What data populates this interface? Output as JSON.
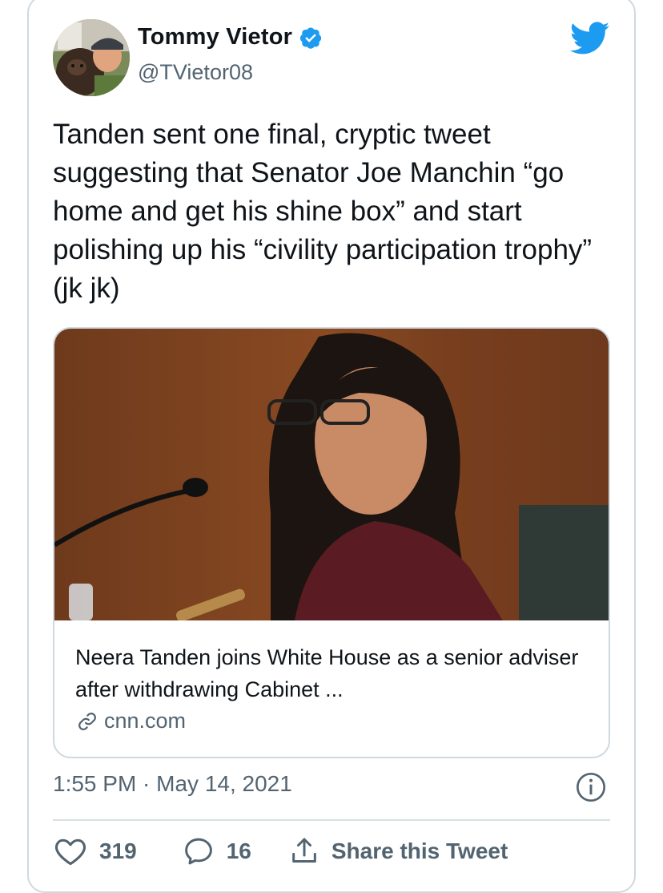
{
  "tweet": {
    "author_name": "Tommy Vietor",
    "author_handle": "@TVietor08",
    "verified_icon": "verified-badge-icon",
    "brand_icon": "twitter-bird-icon",
    "text": "Tanden sent one final, cryptic tweet suggesting that Senator Joe Manchin “go home and get his shine box” and start polishing up his “civility participation trophy” (jk jk)",
    "timestamp": "1:55 PM · May 14, 2021",
    "info_icon": "info-icon"
  },
  "link_card": {
    "title": "Neera Tanden joins White House as a senior adviser after withdrawing Cabinet ...",
    "domain": "cnn.com",
    "domain_icon": "link-icon"
  },
  "actions": {
    "like_count": "319",
    "reply_count": "16",
    "share_label": "Share this Tweet"
  },
  "colors": {
    "brand_blue": "#1d9bf0",
    "secondary_text": "#536471",
    "border": "#cfd9de"
  }
}
